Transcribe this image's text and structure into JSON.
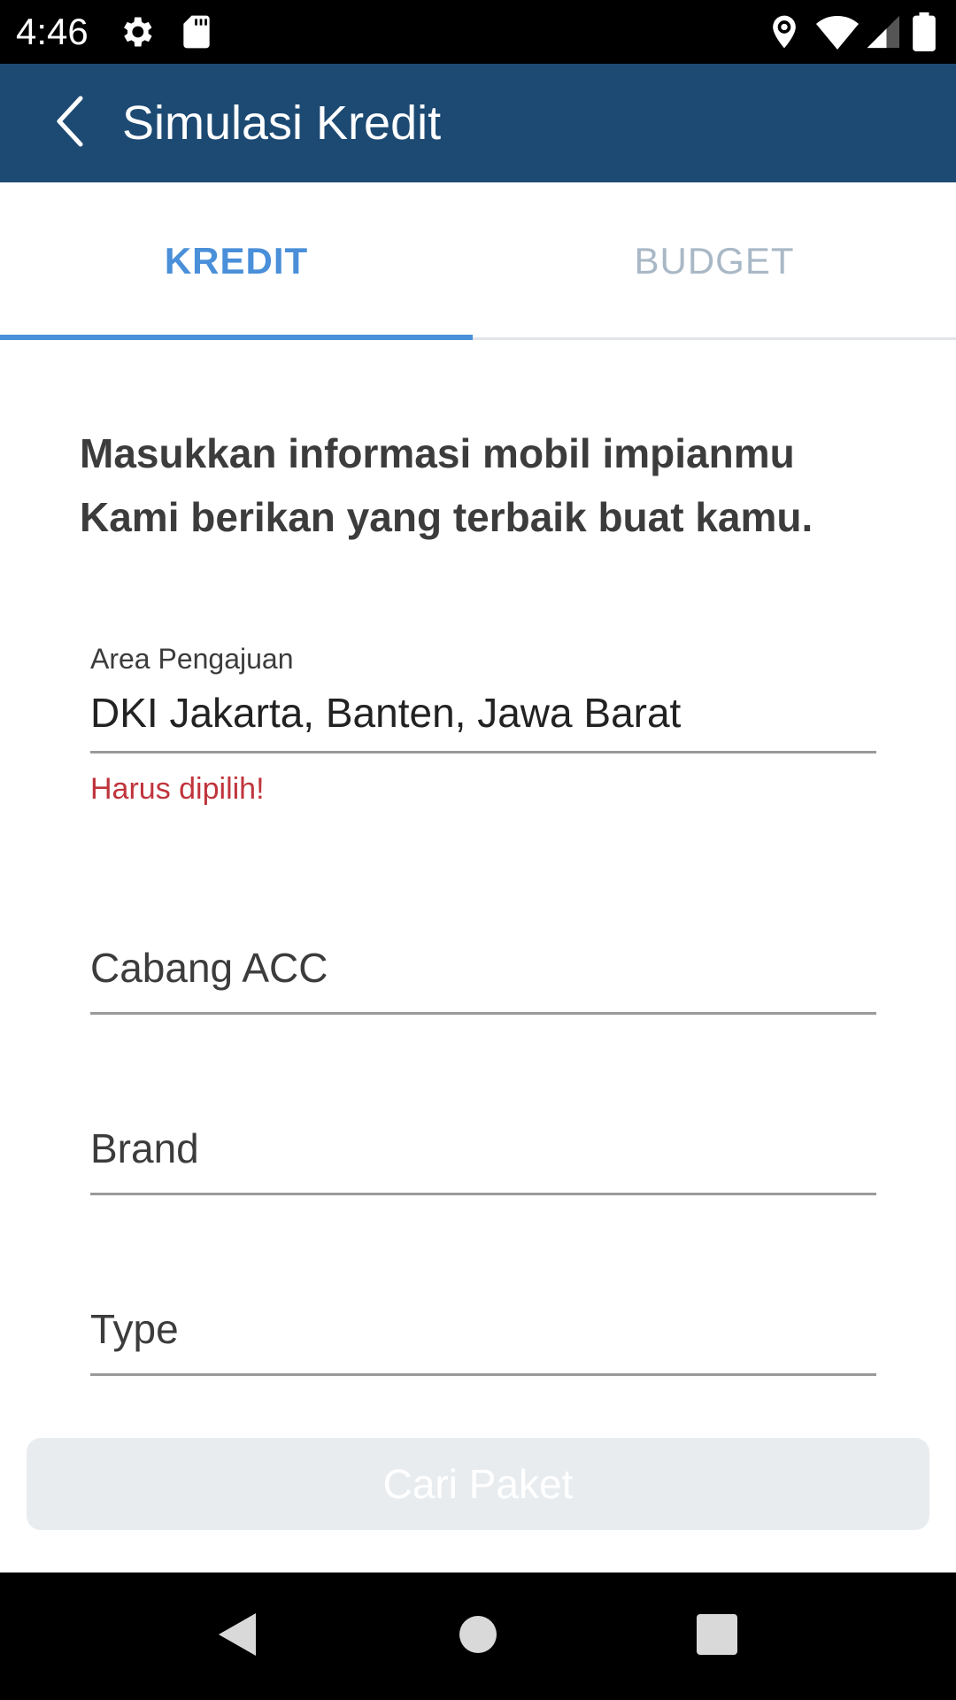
{
  "status_bar": {
    "time": "4:46",
    "left_icons": [
      "gear-icon",
      "sd-card-icon"
    ],
    "right_icons": [
      "location-icon",
      "wifi-icon",
      "signal-icon",
      "battery-icon"
    ]
  },
  "app_bar": {
    "title": "Simulasi Kredit",
    "back_icon": "chevron-left-icon",
    "color": "#1d4a73"
  },
  "tabs": [
    {
      "label": "KREDIT",
      "selected": true
    },
    {
      "label": "BUDGET",
      "selected": false
    }
  ],
  "intro": {
    "line1": "Masukkan informasi mobil impianmu",
    "line2": "Kami berikan yang terbaik buat kamu."
  },
  "form": {
    "area": {
      "label": "Area Pengajuan",
      "value": "DKI Jakarta, Banten, Jawa Barat",
      "error": "Harus dipilih!"
    },
    "cabang": {
      "placeholder": "Cabang ACC"
    },
    "brand": {
      "placeholder": "Brand"
    },
    "type": {
      "placeholder": "Type"
    }
  },
  "search_button": {
    "label": "Cari Paket",
    "enabled": false
  },
  "colors": {
    "accent": "#4a8fd9",
    "error": "#c0343c",
    "tab_inactive": "#a9b8c6",
    "button_disabled": "#e9ecef"
  },
  "nav_bar": {
    "icons": [
      "back-triangle-icon",
      "home-circle-icon",
      "recents-square-icon"
    ]
  }
}
